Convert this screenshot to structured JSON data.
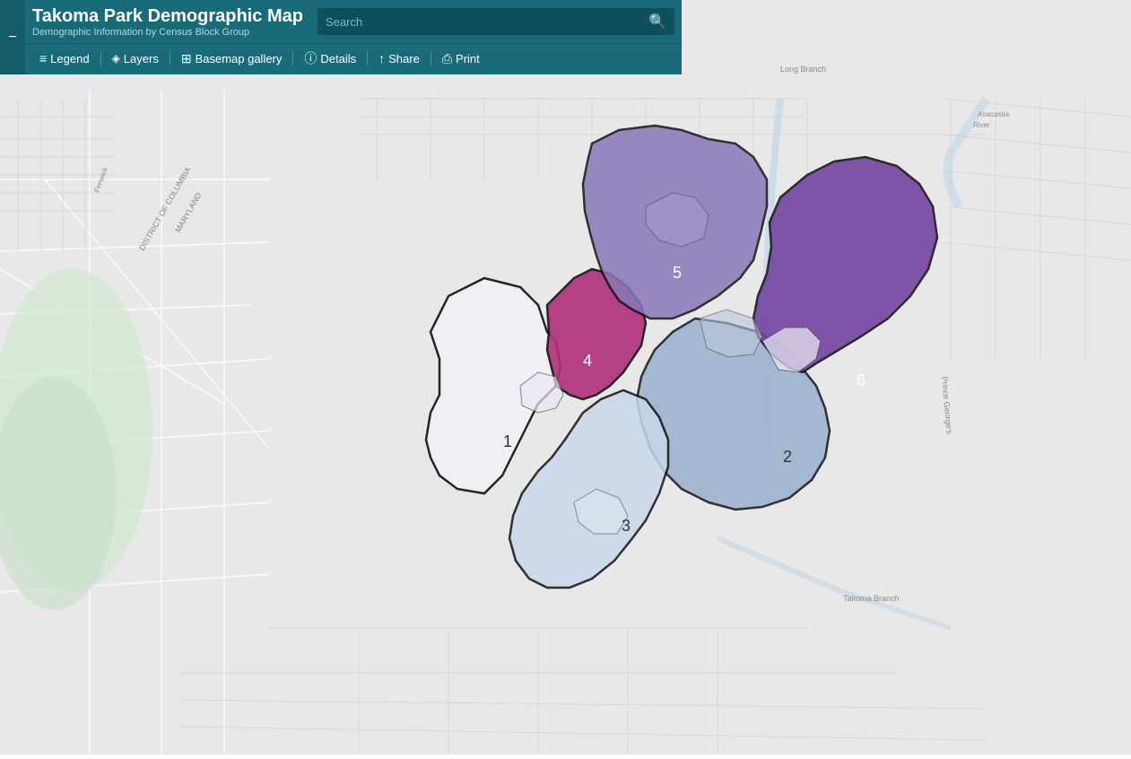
{
  "app": {
    "title": "Takoma Park Demographic Map",
    "subtitle": "Demographic Information by Census Block Group"
  },
  "toolbar": {
    "side_buttons": [
      "+",
      "⌂",
      "−"
    ],
    "search_placeholder": "Search",
    "menu_items": [
      {
        "label": "Legend",
        "icon": "≡",
        "name": "legend"
      },
      {
        "label": "Layers",
        "icon": "◨",
        "name": "layers"
      },
      {
        "label": "Basemap gallery",
        "icon": "⊞",
        "name": "basemap-gallery"
      },
      {
        "label": "Details",
        "icon": "ℹ",
        "name": "details"
      },
      {
        "label": "Share",
        "icon": "↓",
        "name": "share"
      },
      {
        "label": "Print",
        "icon": "🖨",
        "name": "print"
      }
    ]
  },
  "map": {
    "regions": [
      {
        "id": "1",
        "label": "1",
        "color": "#f0f0f8",
        "labelX": 590,
        "labelY": 495
      },
      {
        "id": "2",
        "label": "2",
        "color": "#9ab0cf",
        "labelX": 880,
        "labelY": 510
      },
      {
        "id": "3",
        "label": "3",
        "color": "#c8d8ea",
        "labelX": 745,
        "labelY": 585
      },
      {
        "id": "4",
        "label": "4",
        "color": "#b0307a",
        "labelX": 655,
        "labelY": 405
      },
      {
        "id": "5",
        "label": "5",
        "color": "#8878b8",
        "labelX": 770,
        "labelY": 305
      },
      {
        "id": "6",
        "label": "6",
        "color": "#7040a0",
        "labelX": 960,
        "labelY": 425
      }
    ]
  },
  "icons": {
    "search": "🔍",
    "legend": "≡",
    "layers": "⊕",
    "basemap": "⊞",
    "details": "ⓘ",
    "share": "↑",
    "print": "⎙",
    "home": "⌂",
    "plus": "+",
    "minus": "−"
  }
}
